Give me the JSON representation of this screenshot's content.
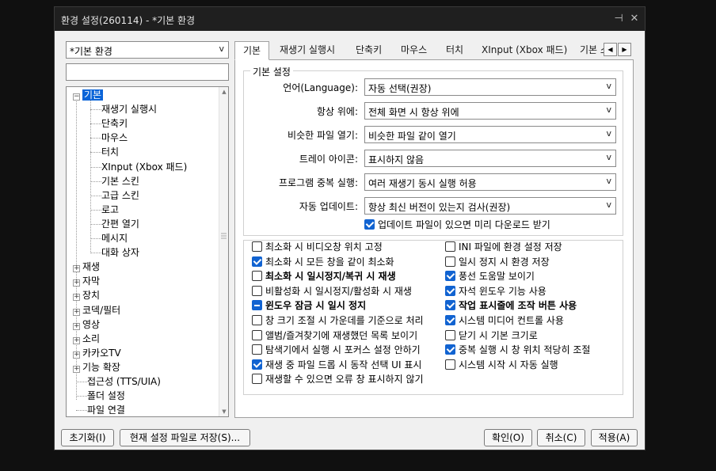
{
  "window": {
    "title": "환경 설정(260114) - *기본 환경",
    "pin_glyph": "⊣",
    "close_glyph": "✕"
  },
  "profile": {
    "selected": "*기본 환경",
    "arrow": "v"
  },
  "search": {
    "value": "",
    "placeholder": ""
  },
  "tree": {
    "items": [
      {
        "label": "기본",
        "expanded": true,
        "selected": true
      },
      {
        "label": "재생기 실행시"
      },
      {
        "label": "단축키"
      },
      {
        "label": "마우스"
      },
      {
        "label": "터치"
      },
      {
        "label": "XInput (Xbox 패드)"
      },
      {
        "label": "기본 스킨"
      },
      {
        "label": "고급 스킨"
      },
      {
        "label": "로고"
      },
      {
        "label": "간편 열기"
      },
      {
        "label": "메시지"
      },
      {
        "label": "대화 상자"
      },
      {
        "label": "재생"
      },
      {
        "label": "자막"
      },
      {
        "label": "장치"
      },
      {
        "label": "코덱/필터"
      },
      {
        "label": "영상"
      },
      {
        "label": "소리"
      },
      {
        "label": "카카오TV"
      },
      {
        "label": "기능 확장"
      },
      {
        "label": "접근성 (TTS/UIA)"
      },
      {
        "label": "폴더 설정"
      },
      {
        "label": "파일 연결"
      }
    ],
    "expand_minus": "−",
    "expand_plus": "+"
  },
  "tabs": [
    "기본",
    "재생기 실행시",
    "단축키",
    "마우스",
    "터치",
    "XInput (Xbox 패드)",
    "기본 스"
  ],
  "tab_nav": {
    "prev": "◀",
    "next": "▶"
  },
  "basic": {
    "legend": "기본 설정",
    "fields": [
      {
        "label": "언어(Language):",
        "value": "자동 선택(권장)"
      },
      {
        "label": "항상 위에:",
        "value": "전체 화면 시 항상 위에"
      },
      {
        "label": "비슷한 파일 열기:",
        "value": "비슷한 파일 같이 열기"
      },
      {
        "label": "트레이 아이콘:",
        "value": "표시하지 않음"
      },
      {
        "label": "프로그램 중복 실행:",
        "value": "여러 재생기 동시 실행 허용"
      },
      {
        "label": "자동 업데이트:",
        "value": "항상 최신 버전이 있는지 검사(권장)"
      }
    ],
    "preload_update": {
      "label": "업데이트 파일이 있으면 미리 다운로드 받기",
      "checked": true
    }
  },
  "options_left": [
    {
      "label": "최소화 시 비디오창 위치 고정",
      "state": "off"
    },
    {
      "label": "최소화 시 모든 창을 같이 최소화",
      "state": "on"
    },
    {
      "label": "최소화 시 일시정지/복귀 시 재생",
      "state": "off",
      "bold": true
    },
    {
      "label": "비활성화 시 일시정지/활성화 시 재생",
      "state": "off"
    },
    {
      "label": "윈도우 잠금 시 일시 정지",
      "state": "mixed",
      "bold": true
    },
    {
      "label": "창 크기 조절 시 가운데를 기준으로 처리",
      "state": "off"
    },
    {
      "label": "앨범/즐겨찾기에 재생했던 목록 보이기",
      "state": "off"
    },
    {
      "label": "탐색기에서 실행 시 포커스 설정 안하기",
      "state": "off"
    },
    {
      "label": "재생 중 파일 드롭 시 동작 선택 UI 표시",
      "state": "on"
    },
    {
      "label": "재생할 수 있으면 오류 창 표시하지 않기",
      "state": "off"
    }
  ],
  "options_right": [
    {
      "label": "INI 파일에 환경 설정 저장",
      "state": "off"
    },
    {
      "label": "일시 정지 시 환경 저장",
      "state": "off"
    },
    {
      "label": "풍선 도움말 보이기",
      "state": "on"
    },
    {
      "label": "자석 윈도우 기능 사용",
      "state": "on"
    },
    {
      "label": "작업 표시줄에 조작 버튼 사용",
      "state": "on",
      "bold": true
    },
    {
      "label": "시스템 미디어 컨트롤 사용",
      "state": "on"
    },
    {
      "label": "닫기 시 기본 크기로",
      "state": "off"
    },
    {
      "label": "중복 실행 시 창 위치 적당히 조절",
      "state": "on"
    },
    {
      "label": "시스템 시작 시 자동 실행",
      "state": "off"
    }
  ],
  "footer": {
    "reset": "초기화(I)",
    "save_to_file": "현재 설정 파일로 저장(S)...",
    "ok": "확인(O)",
    "cancel": "취소(C)",
    "apply": "적용(A)"
  },
  "colors": {
    "accent": "#0a64d8",
    "checkbox": "#1163d1",
    "titlebar": "#1f1f1f",
    "dialog": "#f0f0f0"
  }
}
